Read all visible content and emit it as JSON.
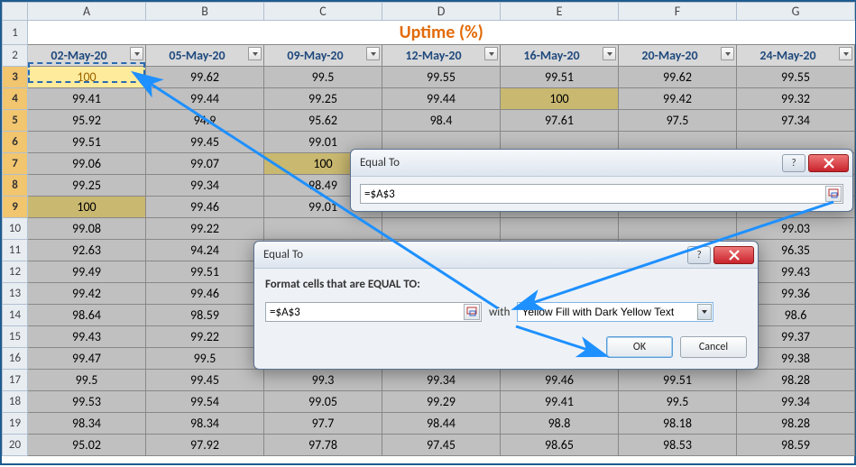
{
  "sheet_title": "Uptime (%)",
  "col_letters": [
    "A",
    "B",
    "C",
    "D",
    "E",
    "F",
    "G"
  ],
  "row_numbers": [
    "1",
    "2",
    "3",
    "4",
    "5",
    "6",
    "7",
    "8",
    "9",
    "10",
    "11",
    "12",
    "13",
    "14",
    "15",
    "16",
    "17",
    "18",
    "19",
    "20"
  ],
  "headers": [
    "02-May-20",
    "05-May-20",
    "09-May-20",
    "12-May-20",
    "16-May-20",
    "20-May-20",
    "24-May-20"
  ],
  "rows": [
    [
      "100",
      "99.62",
      "99.5",
      "99.55",
      "99.51",
      "99.62",
      "99.55"
    ],
    [
      "99.41",
      "99.44",
      "99.25",
      "99.44",
      "100",
      "99.42",
      "99.32"
    ],
    [
      "95.92",
      "94.9",
      "95.62",
      "98.4",
      "97.61",
      "97.5",
      "97.34"
    ],
    [
      "99.51",
      "99.45",
      "99.01",
      "",
      "",
      "",
      ""
    ],
    [
      "99.06",
      "99.07",
      "100",
      "",
      "",
      "",
      ""
    ],
    [
      "99.25",
      "99.34",
      "98.49",
      "",
      "",
      "",
      ""
    ],
    [
      "100",
      "99.46",
      "99.01",
      "",
      "",
      "",
      ""
    ],
    [
      "99.08",
      "99.22",
      "",
      "",
      "",
      "",
      "99.03"
    ],
    [
      "92.63",
      "94.24",
      "",
      "",
      "",
      "",
      "96.35"
    ],
    [
      "99.49",
      "99.51",
      "",
      "",
      "",
      "",
      "99.43"
    ],
    [
      "99.42",
      "99.46",
      "",
      "",
      "",
      "",
      "99.36"
    ],
    [
      "98.64",
      "98.59",
      "",
      "",
      "",
      "",
      "98.6"
    ],
    [
      "99.43",
      "99.22",
      "",
      "",
      "",
      "",
      "99.37"
    ],
    [
      "99.47",
      "99.5",
      "",
      "",
      "",
      "",
      "99.38"
    ],
    [
      "99.5",
      "99.45",
      "99.3",
      "99.34",
      "99.46",
      "99.51",
      "98.28"
    ],
    [
      "99.53",
      "99.54",
      "99.05",
      "99.29",
      "99.41",
      "99.5",
      "99.34"
    ],
    [
      "98.34",
      "98.34",
      "97.7",
      "98.44",
      "98.8",
      "98.18",
      "98.28"
    ],
    [
      "95.02",
      "97.92",
      "97.78",
      "97.45",
      "98.65",
      "98.53",
      "98.59"
    ]
  ],
  "highlights": {
    "yellow": [
      [
        0,
        0
      ]
    ],
    "gold": [
      [
        1,
        4
      ],
      [
        4,
        2
      ],
      [
        6,
        0
      ]
    ]
  },
  "dialog_small": {
    "title": "Equal To",
    "input_value": "=$A$3"
  },
  "dialog_large": {
    "title": "Equal To",
    "prompt": "Format cells that are EQUAL TO:",
    "input_value": "=$A$3",
    "with_label": "with",
    "format_choice": "Yellow Fill with Dark Yellow Text",
    "ok_label": "OK",
    "cancel_label": "Cancel"
  }
}
